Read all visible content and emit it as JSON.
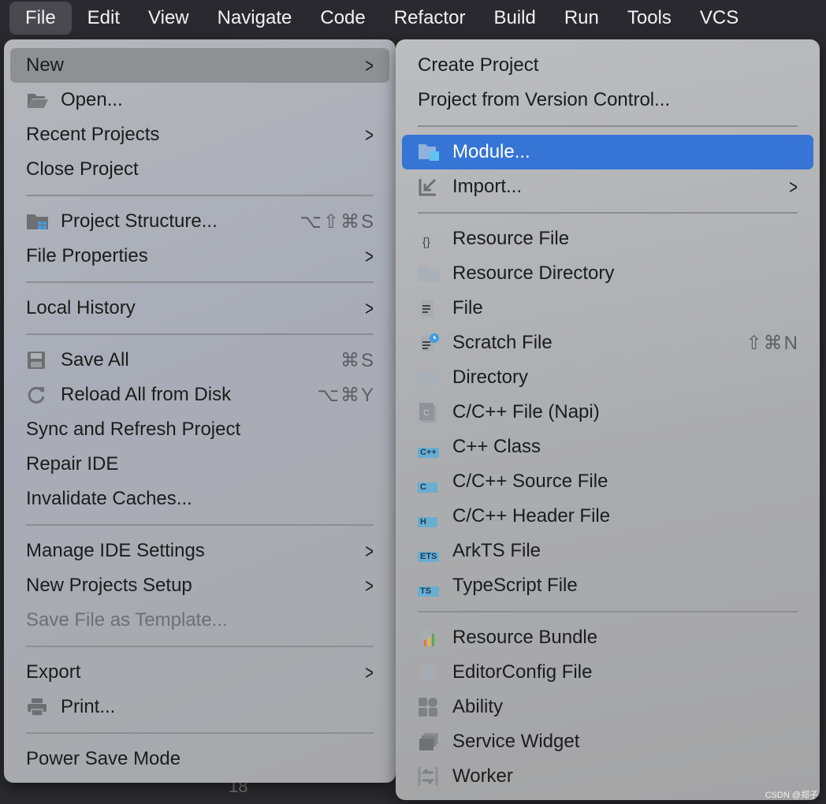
{
  "menubar": [
    "File",
    "Edit",
    "View",
    "Navigate",
    "Code",
    "Refactor",
    "Build",
    "Run",
    "Tools",
    "VCS"
  ],
  "file_menu": {
    "new": "New",
    "open": "Open...",
    "recent": "Recent Projects",
    "close": "Close Project",
    "project_structure": "Project Structure...",
    "project_structure_sc": "⌥⇧⌘S",
    "file_properties": "File Properties",
    "local_history": "Local History",
    "save_all": "Save All",
    "save_all_sc": "⌘S",
    "reload": "Reload All from Disk",
    "reload_sc": "⌥⌘Y",
    "sync": "Sync and Refresh Project",
    "repair": "Repair IDE",
    "invalidate": "Invalidate Caches...",
    "manage": "Manage IDE Settings",
    "new_projects_setup": "New Projects Setup",
    "save_template": "Save File as Template...",
    "export": "Export",
    "print": "Print...",
    "power_save": "Power Save Mode"
  },
  "new_menu": {
    "create_project": "Create Project",
    "from_vcs": "Project from Version Control...",
    "module": "Module...",
    "import": "Import...",
    "resource_file": "Resource File",
    "resource_dir": "Resource Directory",
    "file": "File",
    "scratch": "Scratch File",
    "scratch_sc": "⇧⌘N",
    "directory": "Directory",
    "napi": "C/C++ File (Napi)",
    "cpp_class": "C++ Class",
    "cpp_source": "C/C++ Source File",
    "cpp_header": "C/C++ Header File",
    "arkts": "ArkTS File",
    "typescript": "TypeScript File",
    "resource_bundle": "Resource Bundle",
    "editorconfig": "EditorConfig File",
    "ability": "Ability",
    "service_widget": "Service Widget",
    "worker": "Worker",
    "badges": {
      "cpp": "C++",
      "c": "C",
      "h": "H",
      "ets": "ETS",
      "ts": "TS",
      "resource": "{}"
    }
  },
  "background": {
    "line_number": "18"
  },
  "watermark": "CSDN @郑子",
  "colors": {
    "selection": "#3675d6",
    "menubar": "#2a2930",
    "badge": "#6aaed0"
  }
}
